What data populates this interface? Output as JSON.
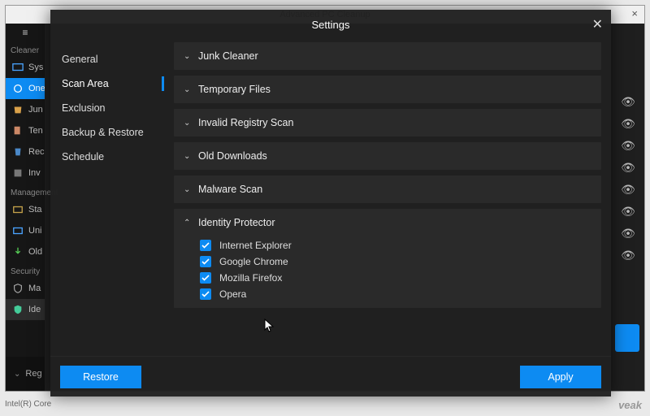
{
  "bg": {
    "title": "Advanced PC Cleanup",
    "close": "×",
    "hamburger": "≡",
    "sections": {
      "cleaner": "Cleaner",
      "management": "Management",
      "security": "Security"
    },
    "items": {
      "sys": "Sys",
      "one": "One",
      "junk": "Jun",
      "temp": "Ten",
      "recycle": "Rec",
      "invalid": "Inv",
      "startup": "Sta",
      "uninstall": "Uni",
      "old": "Old",
      "malware": "Ma",
      "identity": "Ide"
    },
    "reg_label": "Reg",
    "status": "Intel(R) Core",
    "watermark": "veak"
  },
  "modal": {
    "title": "Settings",
    "close": "✕",
    "side": {
      "general": "General",
      "scan_area": "Scan Area",
      "exclusion": "Exclusion",
      "backup": "Backup & Restore",
      "schedule": "Schedule"
    },
    "panels": {
      "junk": "Junk Cleaner",
      "temp": "Temporary Files",
      "registry": "Invalid Registry Scan",
      "downloads": "Old Downloads",
      "malware": "Malware Scan",
      "identity": "Identity Protector"
    },
    "identity_items": {
      "ie": "Internet Explorer",
      "chrome": "Google Chrome",
      "firefox": "Mozilla Firefox",
      "opera": "Opera"
    },
    "buttons": {
      "restore": "Restore",
      "apply": "Apply"
    }
  }
}
